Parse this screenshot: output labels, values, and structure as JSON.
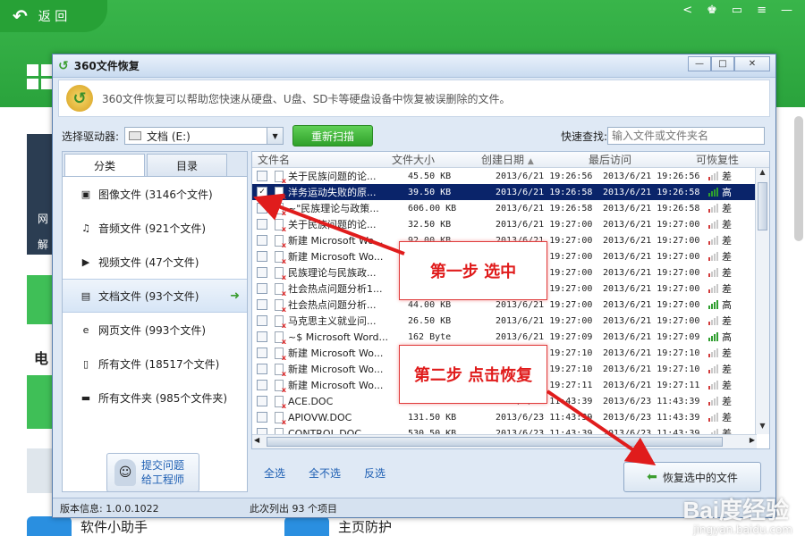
{
  "bg": {
    "back_label": "返 回",
    "left_text": "网",
    "left_text2": "解",
    "dian": "电",
    "bottom_left": "软件小助手",
    "bottom_right": "主页防护"
  },
  "dialog": {
    "title": "360文件恢复",
    "info": "360文件恢复可以帮助您快速从硬盘、U盘、SD卡等硬盘设备中恢复被误删除的文件。",
    "drive_label": "选择驱动器:",
    "drive_value": "文档 (E:)",
    "rescan_label": "重新扫描",
    "quick_label": "快速查找:",
    "search_placeholder": "输入文件或文件夹名",
    "tabs": [
      "分类",
      "目录"
    ],
    "categories": [
      {
        "label": "图像文件 (3146个文件)",
        "icon": "image-icon"
      },
      {
        "label": "音频文件 (921个文件)",
        "icon": "music-icon"
      },
      {
        "label": "视频文件 (47个文件)",
        "icon": "video-icon"
      },
      {
        "label": "文档文件 (93个文件)",
        "icon": "document-icon"
      },
      {
        "label": "网页文件 (993个文件)",
        "icon": "web-icon"
      },
      {
        "label": "所有文件 (18517个文件)",
        "icon": "file-icon"
      },
      {
        "label": "所有文件夹 (985个文件夹)",
        "icon": "folder-icon"
      }
    ],
    "help_line1": "提交问题",
    "help_line2": "给工程师",
    "columns": [
      "文件名",
      "文件大小",
      "创建日期",
      "最后访问",
      "可恢复性"
    ],
    "rows": [
      {
        "name": "关于民族问题的论...",
        "size": "45.50 KB",
        "created": "2013/6/21 19:26:56",
        "accessed": "2013/6/21 19:26:56",
        "rec": "差",
        "checked": false
      },
      {
        "name": "洋务运动失败的原...",
        "size": "39.50 KB",
        "created": "2013/6/21 19:26:58",
        "accessed": "2013/6/21 19:26:58",
        "rec": "高",
        "checked": true
      },
      {
        "name": "~\"民族理论与政策...",
        "size": "606.00 KB",
        "created": "2013/6/21 19:26:58",
        "accessed": "2013/6/21 19:26:58",
        "rec": "差",
        "checked": false
      },
      {
        "name": "关于民族问题的论...",
        "size": "32.50 KB",
        "created": "2013/6/21 19:27:00",
        "accessed": "2013/6/21 19:27:00",
        "rec": "差",
        "checked": false
      },
      {
        "name": "新建 Microsoft Wo...",
        "size": "92.00 KB",
        "created": "2013/6/21 19:27:00",
        "accessed": "2013/6/21 19:27:00",
        "rec": "差",
        "checked": false
      },
      {
        "name": "新建 Microsoft Wo...",
        "size": "",
        "created": "2013/6/21 19:27:00",
        "accessed": "2013/6/21 19:27:00",
        "rec": "差",
        "checked": false
      },
      {
        "name": "民族理论与民族政...",
        "size": "",
        "created": "2013/6/21 19:27:00",
        "accessed": "2013/6/21 19:27:00",
        "rec": "差",
        "checked": false
      },
      {
        "name": "社会热点问题分析1...",
        "size": "",
        "created": "2013/6/21 19:27:00",
        "accessed": "2013/6/21 19:27:00",
        "rec": "差",
        "checked": false
      },
      {
        "name": "社会热点问题分析...",
        "size": "44.00 KB",
        "created": "2013/6/21 19:27:00",
        "accessed": "2013/6/21 19:27:00",
        "rec": "高",
        "checked": false
      },
      {
        "name": "马克思主义就业问...",
        "size": "26.50 KB",
        "created": "2013/6/21 19:27:00",
        "accessed": "2013/6/21 19:27:00",
        "rec": "差",
        "checked": false
      },
      {
        "name": "~$ Microsoft Word...",
        "size": "162 Byte",
        "created": "2013/6/21 19:27:09",
        "accessed": "2013/6/21 19:27:09",
        "rec": "高",
        "checked": false
      },
      {
        "name": "新建 Microsoft Wo...",
        "size": "",
        "created": "2013/6/21 19:27:10",
        "accessed": "2013/6/21 19:27:10",
        "rec": "差",
        "checked": false
      },
      {
        "name": "新建 Microsoft Wo...",
        "size": "",
        "created": "2013/6/21 19:27:10",
        "accessed": "2013/6/21 19:27:10",
        "rec": "差",
        "checked": false
      },
      {
        "name": "新建 Microsoft Wo...",
        "size": "",
        "created": "2013/6/21 19:27:11",
        "accessed": "2013/6/21 19:27:11",
        "rec": "差",
        "checked": false
      },
      {
        "name": "ACE.DOC",
        "size": "3.40 MB",
        "created": "2013/6/23 11:43:39",
        "accessed": "2013/6/23 11:43:39",
        "rec": "差",
        "checked": false
      },
      {
        "name": "APIOVW.DOC",
        "size": "131.50 KB",
        "created": "2013/6/23 11:43:39",
        "accessed": "2013/6/23 11:43:39",
        "rec": "差",
        "checked": false
      },
      {
        "name": "CONTROL.DOC",
        "size": "530.50 KB",
        "created": "2013/6/23 11:43:39",
        "accessed": "2013/6/23 11:43:39",
        "rec": "差",
        "checked": false
      }
    ],
    "select_all": "全选",
    "deselect_all": "全不选",
    "invert": "反选",
    "recover_label": "恢复选中的文件",
    "version": "版本信息: 1.0.0.1022",
    "status": "此次列出 93 个项目"
  },
  "annotations": {
    "step1": "第一步  选中",
    "step2": "第二步  点击恢复"
  },
  "watermark": "Bai度经验",
  "watermark_url": "jingyan.baidu.com",
  "colors": {
    "accent_green": "#39b54a",
    "selection": "#0a246a",
    "annotation_red": "#e01c1c",
    "high": "#2f9e2f",
    "low": "#d23a3a"
  }
}
